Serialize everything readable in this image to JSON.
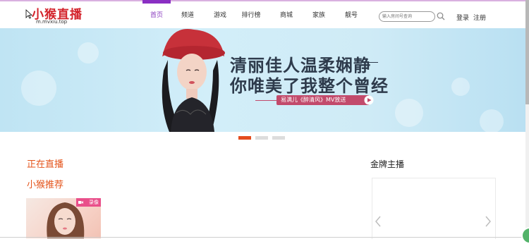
{
  "header": {
    "logo_title": "小猴直播",
    "logo_subtitle": "m.mvxiu.top",
    "nav": [
      "首页",
      "频道",
      "游戏",
      "排行榜",
      "商城",
      "家族",
      "靓号"
    ],
    "active_nav": 0,
    "search": {
      "placeholder": "输入房间号查询"
    },
    "login": "登录",
    "register": "注册"
  },
  "banner": {
    "headline_line1": "清丽佳人温柔娴静",
    "headline_line2": "你唯美了我整个曾经",
    "promo": "易满儿《醉清风》MV放送",
    "slide_count": 3,
    "active_slide": 0
  },
  "main": {
    "live_title": "正在直播",
    "recommend_title": "小猴推荐",
    "record_badge": "录像"
  },
  "sidebar": {
    "gold_title": "金牌主播"
  },
  "colors": {
    "nav_accent": "#8a2fc3",
    "section_title": "#e4541b",
    "record_badge": "#e94f8a",
    "promo_badge": "#c24a6b"
  }
}
